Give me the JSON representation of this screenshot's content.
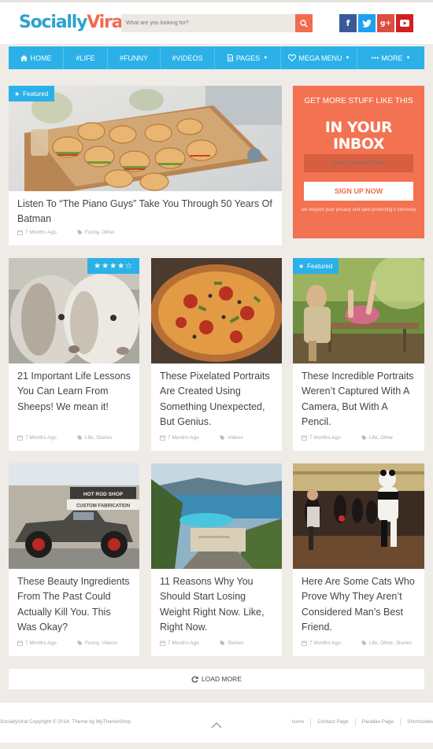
{
  "brand": {
    "part1": "Socially",
    "part2": "Viral"
  },
  "search": {
    "placeholder": "What are you looking for?"
  },
  "social": [
    {
      "icon": "facebook-icon",
      "glyph": "f",
      "color": "#3b5998"
    },
    {
      "icon": "twitter-icon",
      "glyph": "t",
      "color": "#1da1f2"
    },
    {
      "icon": "google-plus-icon",
      "glyph": "g+",
      "color": "#dc4e41"
    },
    {
      "icon": "youtube-icon",
      "glyph": "▶",
      "color": "#d31f1f"
    }
  ],
  "nav": {
    "items": [
      {
        "label": "HOME",
        "icon": "home-icon"
      },
      {
        "label": "#LIFE"
      },
      {
        "label": "#FUNNY"
      },
      {
        "label": "#VIDEOS"
      },
      {
        "label": "PAGES",
        "icon": "document-icon",
        "dropdown": true
      },
      {
        "label": "MEGA MENU",
        "icon": "heart-icon",
        "dropdown": true
      },
      {
        "label": "MORE",
        "icon": "dots-icon",
        "dropdown": true
      }
    ]
  },
  "featured": {
    "badge": "Featured",
    "title": "Listen To “The Piano Guys” Take You Through 50 Years Of Batman",
    "time": "7 Months Ago",
    "tags": "Funny, Other"
  },
  "sidebar": {
    "line1": "GET MORE STUFF LIKE THIS",
    "line2": "IN YOUR INBOX",
    "email_placeholder": "Enter your email here",
    "button": "SIGN UP NOW",
    "note": "we respect your privacy and take protecting it seriously"
  },
  "posts": [
    {
      "title": "21 Important Life Lessons You Can Learn From Sheeps! We mean it!",
      "time": "7 Months Ago",
      "tags": "Life, Stories",
      "rating": 4,
      "max_rating": 5
    },
    {
      "title": "These Pixelated Portraits Are Created Using Something Unexpected, But Genius.",
      "time": "7 Months Ago",
      "tags": "Videos"
    },
    {
      "title": "These Incredible Portraits Weren’t Captured With A Camera, But With A Pencil.",
      "time": "7 Months Ago",
      "tags": "Life, Other",
      "badge": "Featured"
    },
    {
      "title": "These Beauty Ingredients From The Past Could Actually Kill You. This Was Okay?",
      "time": "7 Months Ago",
      "tags": "Funny, Videos",
      "sign1": "HOT ROD SHOP",
      "sign2": "CUSTOM FABRICATION"
    },
    {
      "title": "11 Reasons Why You Should Start Losing Weight Right Now. Like, Right Now.",
      "time": "7 Months Ago",
      "tags": "Stories"
    },
    {
      "title": "Here Are Some Cats Who Prove Why They Aren’t Considered Man’s Best Friend.",
      "time": "7 Months Ago",
      "tags": "Life, Other, Stories"
    }
  ],
  "stars": "★★★★☆",
  "load_more": "LOAD MORE",
  "footer": {
    "copyright": "SociallyViral Copyright © 2014. Theme by MyThemeShop",
    "links": [
      "Icons",
      "Contact Page",
      "Parallax Page",
      "Shortcodes"
    ]
  },
  "colors": {
    "accent": "#2bb1e8",
    "brand_orange": "#f26b4d",
    "background": "#efebe7"
  }
}
